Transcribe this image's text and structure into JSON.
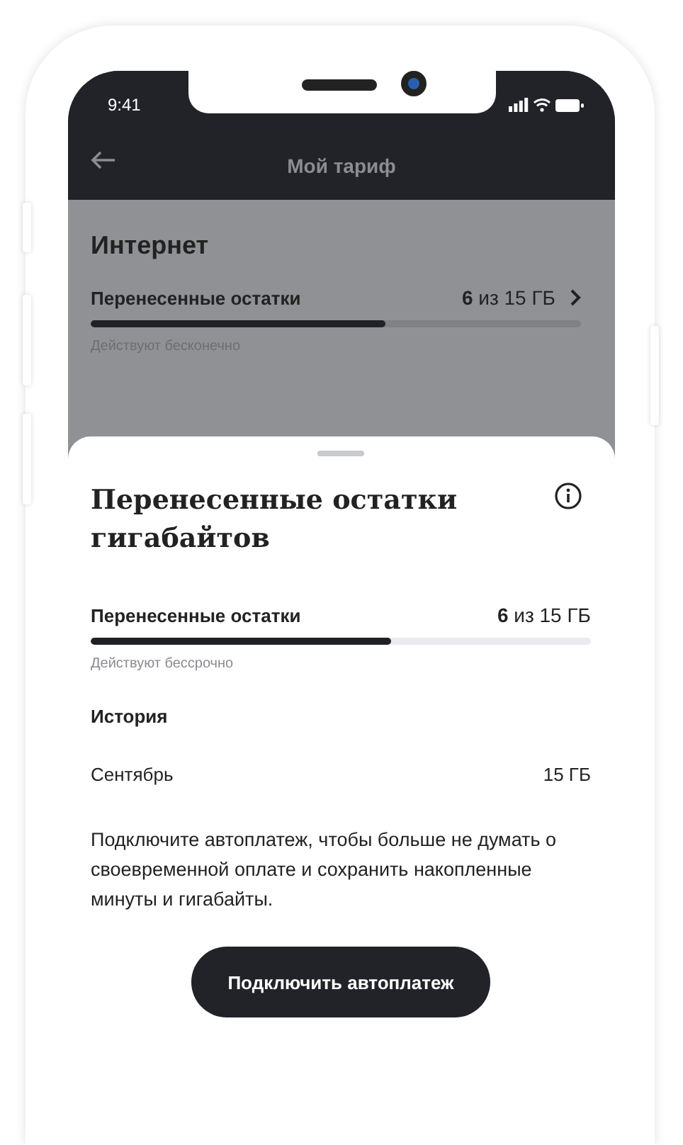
{
  "status_bar": {
    "time": "9:41"
  },
  "header": {
    "title": "Мой тариф"
  },
  "background_section": {
    "title": "Интернет",
    "items": [
      {
        "label": "Перенесенные остатки",
        "value": "**6** из 15 ГБ",
        "level": 0.6,
        "note": "Действуют бесконечно"
      }
    ]
  },
  "sheet": {
    "title": "Перенесенные остатки гигабайтов",
    "usage": {
      "label": "Перенесенные остатки",
      "value": "**6** из 15 ГБ",
      "level": 0.6,
      "note": "Действуют бессрочно"
    },
    "history_title": "История",
    "history": [
      {
        "month": "Сентябрь",
        "amount": "15 ГБ"
      }
    ],
    "message": "Подключите автоплатеж, чтобы больше не думать о своевременной оплате и сохранить накопленные минуты и гигабайты.",
    "button": "Подключить автоплатеж"
  }
}
